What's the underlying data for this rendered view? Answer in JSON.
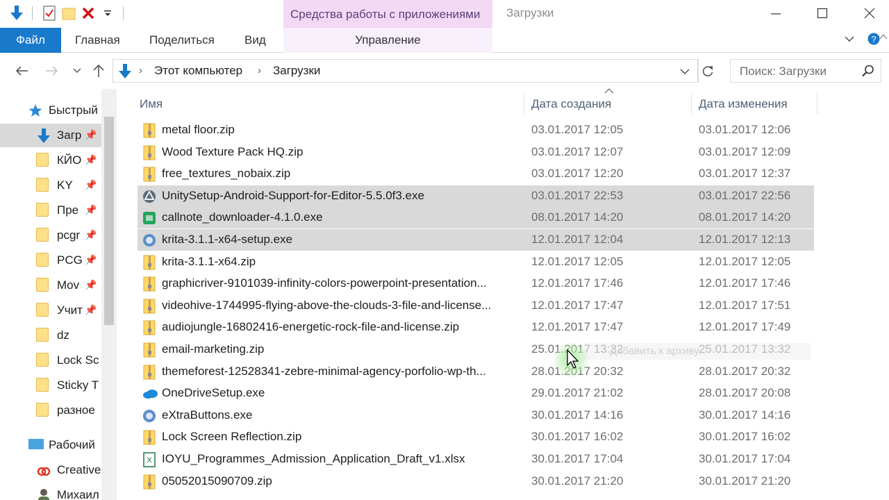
{
  "titlebar": {
    "contextual_tab": "Средства работы с приложениями",
    "window_title": "Загрузки"
  },
  "ribbon": {
    "file": "Файл",
    "home": "Главная",
    "share": "Поделиться",
    "view": "Вид",
    "manage": "Управление"
  },
  "address": {
    "segments": [
      "Этот компьютер",
      "Загрузки"
    ]
  },
  "search": {
    "placeholder": "Поиск: Загрузки"
  },
  "sidebar": {
    "items": [
      {
        "label": "Быстрый",
        "kind": "star"
      },
      {
        "label": "Загр",
        "kind": "download",
        "selected": true,
        "pinned": true
      },
      {
        "label": "КЙО",
        "kind": "folder",
        "pinned": true
      },
      {
        "label": "KY",
        "kind": "folder",
        "pinned": true
      },
      {
        "label": "Пре",
        "kind": "folder",
        "pinned": true
      },
      {
        "label": "pcgr",
        "kind": "folder",
        "pinned": true
      },
      {
        "label": "PCG",
        "kind": "folder",
        "pinned": true
      },
      {
        "label": "Mov",
        "kind": "folder",
        "pinned": true
      },
      {
        "label": "Учит",
        "kind": "folder",
        "pinned": true
      },
      {
        "label": "dz",
        "kind": "folder"
      },
      {
        "label": "Lock Sc",
        "kind": "folder"
      },
      {
        "label": "Sticky T",
        "kind": "folder"
      },
      {
        "label": "разное",
        "kind": "folder"
      },
      {
        "label": "Рабочий",
        "kind": "desktop"
      },
      {
        "label": "Creative",
        "kind": "creative"
      },
      {
        "label": "Михаил",
        "kind": "user"
      }
    ]
  },
  "columns": {
    "name": "Имя",
    "created": "Дата создания",
    "modified": "Дата изменения"
  },
  "files": [
    {
      "name": "metal floor.zip",
      "created": "03.01.2017 12:05",
      "modified": "03.01.2017 12:06",
      "icon": "zip-icon"
    },
    {
      "name": "Wood Texture Pack HQ.zip",
      "created": "03.01.2017 12:07",
      "modified": "03.01.2017 12:09",
      "icon": "zip-icon"
    },
    {
      "name": "free_textures_nobaix.zip",
      "created": "03.01.2017 12:20",
      "modified": "03.01.2017 12:37",
      "icon": "zip-icon"
    },
    {
      "name": "UnitySetup-Android-Support-for-Editor-5.5.0f3.exe",
      "created": "03.01.2017 22:53",
      "modified": "03.01.2017 22:56",
      "icon": "unity-icon",
      "selected": true
    },
    {
      "name": "callnote_downloader-4.1.0.exe",
      "created": "08.01.2017 14:20",
      "modified": "08.01.2017 14:20",
      "icon": "callnote-icon",
      "selected": true
    },
    {
      "name": "krita-3.1.1-x64-setup.exe",
      "created": "12.01.2017 12:04",
      "modified": "12.01.2017 12:13",
      "icon": "installer-icon",
      "selected": true
    },
    {
      "name": "krita-3.1.1-x64.zip",
      "created": "12.01.2017 12:05",
      "modified": "12.01.2017 12:05",
      "icon": "zip-icon"
    },
    {
      "name": "graphicriver-9101039-infinity-colors-powerpoint-presentation...",
      "created": "12.01.2017 17:46",
      "modified": "12.01.2017 17:46",
      "icon": "zip-icon"
    },
    {
      "name": "videohive-1744995-flying-above-the-clouds-3-file-and-license...",
      "created": "12.01.2017 17:47",
      "modified": "12.01.2017 17:51",
      "icon": "zip-icon"
    },
    {
      "name": "audiojungle-16802416-energetic-rock-file-and-license.zip",
      "created": "12.01.2017 17:47",
      "modified": "12.01.2017 17:49",
      "icon": "zip-icon"
    },
    {
      "name": "email-marketing.zip",
      "created": "25.01.2017 13:32",
      "modified": "25.01.2017 13:32",
      "icon": "zip-icon"
    },
    {
      "name": "themeforest-12528341-zebre-minimal-agency-porfolio-wp-th...",
      "created": "28.01.2017 20:32",
      "modified": "28.01.2017 20:32",
      "icon": "zip-icon"
    },
    {
      "name": "OneDriveSetup.exe",
      "created": "29.01.2017 21:02",
      "modified": "28.01.2017 20:08",
      "icon": "onedrive-icon"
    },
    {
      "name": "eXtraButtons.exe",
      "created": "30.01.2017 14:16",
      "modified": "30.01.2017 14:16",
      "icon": "installer-icon"
    },
    {
      "name": "Lock Screen Reflection.zip",
      "created": "30.01.2017 16:02",
      "modified": "30.01.2017 16:02",
      "icon": "zip-icon"
    },
    {
      "name": "IOYU_Programmes_Admission_Application_Draft_v1.xlsx",
      "created": "30.01.2017 17:04",
      "modified": "30.01.2017 17:04",
      "icon": "excel-icon"
    },
    {
      "name": "05052015090709.zip",
      "created": "30.01.2017 21:20",
      "modified": "30.01.2017 21:20",
      "icon": "zip-icon"
    }
  ],
  "colors": {
    "file_tab": "#1979ca",
    "contextual_tab": "#f3d9f6",
    "selection": "#d9d9d9",
    "header_text": "#4c607a"
  }
}
